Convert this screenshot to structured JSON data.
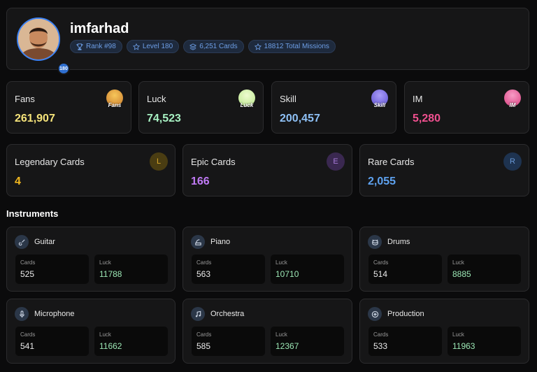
{
  "profile": {
    "username": "imfarhad",
    "level_badge": "180",
    "pills": [
      {
        "icon": "trophy-icon",
        "text": "Rank #98"
      },
      {
        "icon": "star-icon",
        "text": "Level 180"
      },
      {
        "icon": "layers-icon",
        "text": "6,251 Cards"
      },
      {
        "icon": "star-icon",
        "text": "18812 Total Missions"
      }
    ]
  },
  "stats": [
    {
      "label": "Fans",
      "value": "261,907",
      "icon_text": "Fans",
      "color": "#f5e37a",
      "icon_color": "#e8a43a"
    },
    {
      "label": "Luck",
      "value": "74,523",
      "icon_text": "Luck",
      "color": "#a7f0c2",
      "icon_color": "#d8f6b0"
    },
    {
      "label": "Skill",
      "value": "200,457",
      "icon_text": "Skill",
      "color": "#8ec0f5",
      "icon_color": "#8a7cf0"
    },
    {
      "label": "IM",
      "value": "5,280",
      "icon_text": "IM",
      "color": "#f0508f",
      "icon_color": "#f06aa8"
    }
  ],
  "rarities": [
    {
      "label": "Legendary Cards",
      "value": "4",
      "badge": "L",
      "color": "#f2b81f",
      "badge_bg": "#4a3d12",
      "badge_fg": "#d9a82a"
    },
    {
      "label": "Epic Cards",
      "value": "166",
      "badge": "E",
      "color": "#c07af5",
      "badge_bg": "#3a2850",
      "badge_fg": "#a87ad8"
    },
    {
      "label": "Rare Cards",
      "value": "2,055",
      "badge": "R",
      "color": "#5ea2f0",
      "badge_bg": "#1e3350",
      "badge_fg": "#6a9ad8"
    }
  ],
  "instruments_title": "Instruments",
  "instruments": [
    {
      "name": "Guitar",
      "icon": "guitar-icon",
      "cards_label": "Cards",
      "cards": "525",
      "luck_label": "Luck",
      "luck": "11788"
    },
    {
      "name": "Piano",
      "icon": "piano-icon",
      "cards_label": "Cards",
      "cards": "563",
      "luck_label": "Luck",
      "luck": "10710"
    },
    {
      "name": "Drums",
      "icon": "drums-icon",
      "cards_label": "Cards",
      "cards": "514",
      "luck_label": "Luck",
      "luck": "8885"
    },
    {
      "name": "Microphone",
      "icon": "microphone-icon",
      "cards_label": "Cards",
      "cards": "541",
      "luck_label": "Luck",
      "luck": "11662"
    },
    {
      "name": "Orchestra",
      "icon": "music-note-icon",
      "cards_label": "Cards",
      "cards": "585",
      "luck_label": "Luck",
      "luck": "12367"
    },
    {
      "name": "Production",
      "icon": "production-icon",
      "cards_label": "Cards",
      "cards": "533",
      "luck_label": "Luck",
      "luck": "11963"
    }
  ],
  "colors": {
    "luck_value": "#9be6b4",
    "cards_value": "#eaeaea",
    "accent": "#3b82f6"
  }
}
